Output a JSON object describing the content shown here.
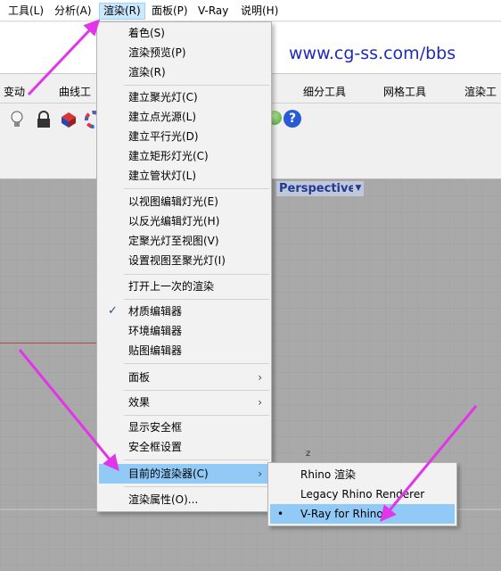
{
  "menubar": {
    "items": [
      "工具(L)",
      "分析(A)",
      "渲染(R)",
      "面板(P)",
      "V-Ray",
      "说明(H)"
    ]
  },
  "watermark": "www.cg-ss.com/bbs",
  "tabs": [
    "变动",
    "曲线工",
    "细分工具",
    "网格工具",
    "渲染工"
  ],
  "toolbar": {
    "help_glyph": "?"
  },
  "viewport": {
    "title": "Perspective",
    "dropdown_glyph": "▼",
    "axis_label": "z"
  },
  "render_menu": {
    "items": [
      "着色(S)",
      "渲染预览(P)",
      "渲染(R)",
      "建立聚光灯(C)",
      "建立点光源(L)",
      "建立平行光(D)",
      "建立矩形灯光(C)",
      "建立管状灯(L)",
      "以视图编辑灯光(E)",
      "以反光编辑灯光(H)",
      "定聚光灯至视图(V)",
      "设置视图至聚光灯(I)",
      "打开上一次的渲染",
      "材质编辑器",
      "环境编辑器",
      "贴图编辑器",
      "面板",
      "效果",
      "显示安全框",
      "安全框设置",
      "目前的渲染器(C)",
      "渲染属性(O)..."
    ],
    "check_glyph": "✓",
    "submenu_arrow": "›"
  },
  "renderer_submenu": {
    "items": [
      "Rhino 渲染",
      "Legacy Rhino Renderer",
      "V-Ray for Rhino"
    ],
    "selected_glyph": "•"
  },
  "colors": {
    "highlight": "#91c9f7",
    "menubar_active": "#cce8ff",
    "watermark": "#1d2bb8",
    "annotation_arrow": "#e234e8",
    "viewport_bg": "#a9a9a9"
  }
}
